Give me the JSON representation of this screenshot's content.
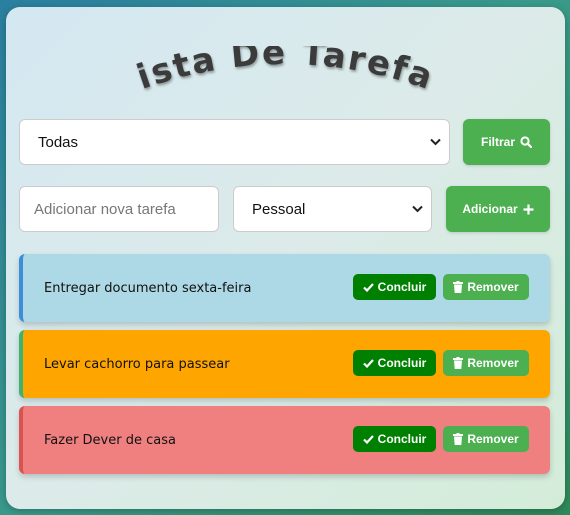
{
  "app": {
    "title": "Lista De Tarefas"
  },
  "filter": {
    "selected": "Todas",
    "button_label": "Filtrar",
    "button_icon": "search-icon"
  },
  "add_form": {
    "input_placeholder": "Adicionar nova tarefa",
    "category_selected": "Pessoal",
    "button_label": "Adicionar",
    "button_icon": "plus-icon"
  },
  "tasks": [
    {
      "text": "Entregar documento sexta-feira",
      "bg": "#add8e6",
      "border": "#3a8fd8"
    },
    {
      "text": "Levar cachorro para passear",
      "bg": "#ffa500",
      "border": "#3cb371"
    },
    {
      "text": "Fazer Dever de casa",
      "bg": "#f08080",
      "border": "#d9534f"
    }
  ],
  "task_actions": {
    "complete_label": "Concluir",
    "complete_icon": "check-icon",
    "remove_label": "Remover",
    "remove_icon": "trash-icon"
  },
  "colors": {
    "primary_button": "#4caf50",
    "complete_button": "#008000"
  }
}
